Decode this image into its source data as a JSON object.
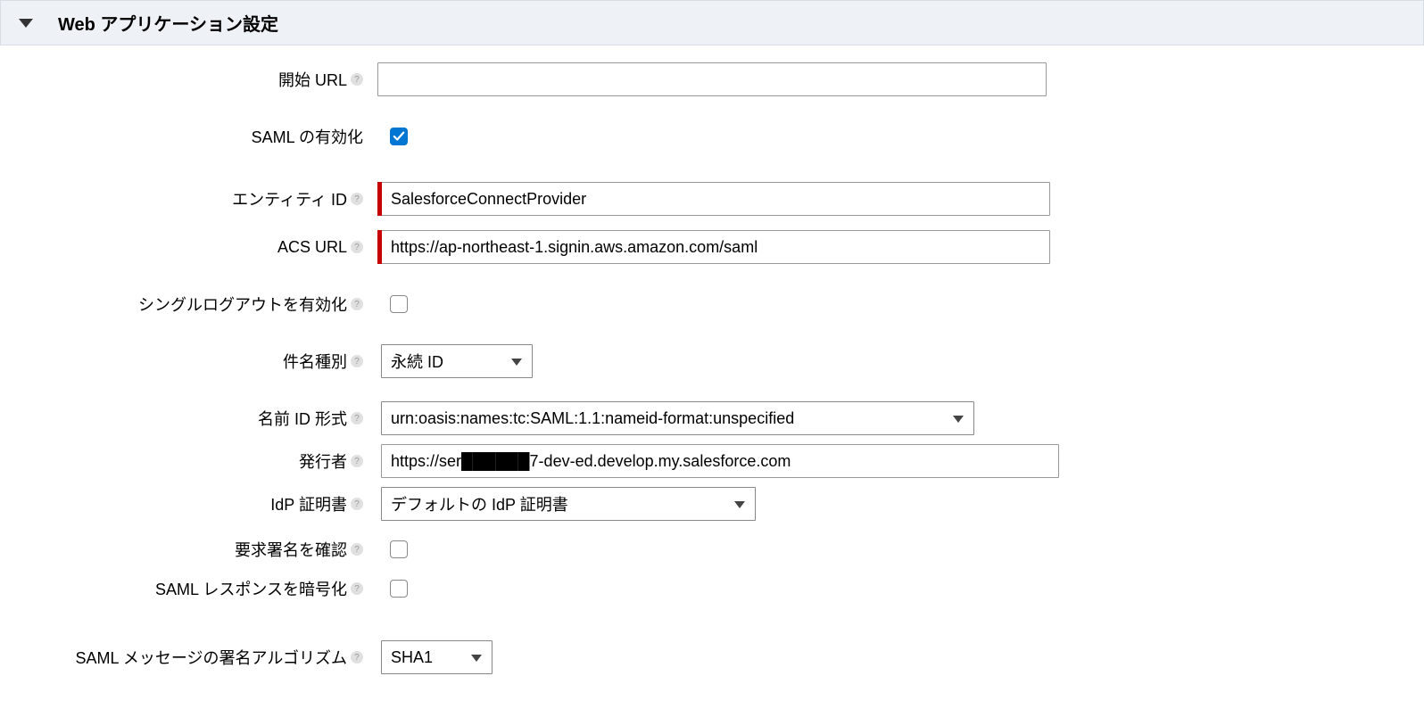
{
  "section": {
    "title": "Web アプリケーション設定"
  },
  "fields": {
    "start_url": {
      "label": "開始 URL",
      "value": ""
    },
    "enable_saml": {
      "label": "SAML の有効化",
      "checked": true
    },
    "entity_id": {
      "label": "エンティティ ID",
      "value": "SalesforceConnectProvider"
    },
    "acs_url": {
      "label": "ACS URL",
      "value": "https://ap-northeast-1.signin.aws.amazon.com/saml"
    },
    "enable_slo": {
      "label": "シングルログアウトを有効化",
      "checked": false
    },
    "subject_type": {
      "label": "件名種別",
      "selected": "永続 ID"
    },
    "nameid_format": {
      "label": "名前 ID 形式",
      "selected": "urn:oasis:names:tc:SAML:1.1:nameid-format:unspecified"
    },
    "issuer": {
      "label": "発行者",
      "value": "https://ser██████7-dev-ed.develop.my.salesforce.com"
    },
    "idp_cert": {
      "label": "IdP 証明書",
      "selected": "デフォルトの IdP 証明書"
    },
    "verify_request_sig": {
      "label": "要求署名を確認",
      "checked": false
    },
    "encrypt_saml_response": {
      "label": "SAML レスポンスを暗号化",
      "checked": false
    },
    "signing_algo": {
      "label": "SAML メッセージの署名アルゴリズム",
      "selected": "SHA1"
    }
  }
}
